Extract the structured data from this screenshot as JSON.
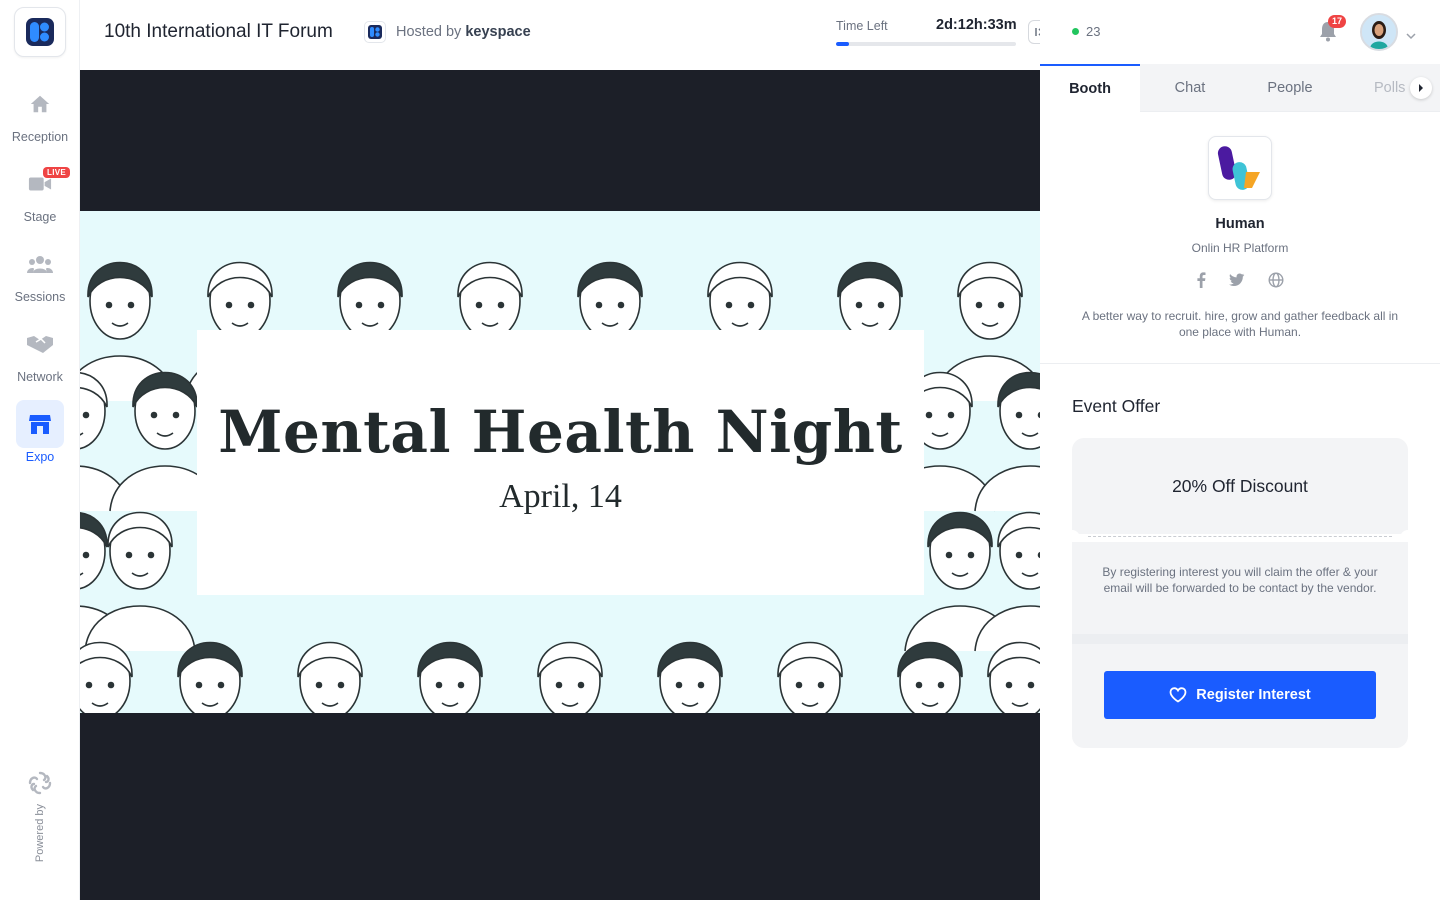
{
  "nav": {
    "items": [
      {
        "label": "Reception",
        "icon": "home-icon"
      },
      {
        "label": "Stage",
        "icon": "video-camera-icon",
        "badge": "LIVE"
      },
      {
        "label": "Sessions",
        "icon": "users-group-icon"
      },
      {
        "label": "Network",
        "icon": "handshake-icon"
      },
      {
        "label": "Expo",
        "icon": "storefront-icon",
        "active": true
      }
    ],
    "powered_by": "Powered by"
  },
  "header": {
    "event_title": "10th International IT Forum",
    "hosted_prefix": "Hosted by",
    "host_name": "keyspace",
    "time_left_label": "Time Left",
    "time_left_value": "2d:12h:33m",
    "time_progress_percent": 7
  },
  "banner": {
    "title": "Mental Health Night",
    "date": "April, 14"
  },
  "topbar": {
    "online_count": "23",
    "notification_count": "17"
  },
  "tabs": [
    {
      "label": "Booth",
      "active": true
    },
    {
      "label": "Chat"
    },
    {
      "label": "People"
    },
    {
      "label": "Polls"
    }
  ],
  "booth": {
    "name": "Human",
    "tagline": "Onlin HR Platform",
    "socials": [
      "facebook-icon",
      "twitter-icon",
      "globe-icon"
    ],
    "description": "A better way to recruit. hire, grow and gather feedback all in one place with Human."
  },
  "offer": {
    "section_title": "Event Offer",
    "headline": "20% Off Discount",
    "details": "By registering interest you will claim the offer & your email will be forwarded to be contact by the vendor.",
    "button_label": "Register Interest"
  },
  "colors": {
    "accent": "#1a5cff",
    "live": "#ef4444",
    "online": "#22c55e",
    "video_bg": "#1c1f28",
    "banner_bg": "#e6fafc"
  }
}
